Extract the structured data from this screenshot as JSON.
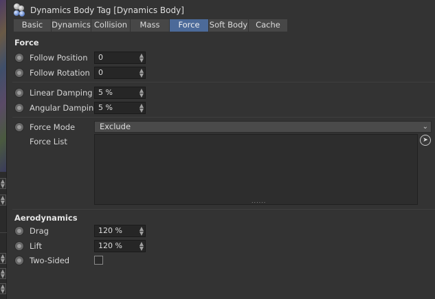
{
  "header": {
    "title": "Dynamics Body Tag [Dynamics Body]"
  },
  "tabs": [
    {
      "label": "Basic"
    },
    {
      "label": "Dynamics"
    },
    {
      "label": "Collision"
    },
    {
      "label": "Mass"
    },
    {
      "label": "Force",
      "active": true
    },
    {
      "label": "Soft Body"
    },
    {
      "label": "Cache"
    }
  ],
  "force": {
    "title": "Force",
    "follow_position": {
      "label": "Follow Position",
      "value": "0"
    },
    "follow_rotation": {
      "label": "Follow Rotation",
      "value": "0"
    },
    "linear_damping": {
      "label": "Linear Damping",
      "value": "5 %"
    },
    "angular_damping": {
      "label": "Angular Damping",
      "value": "5 %"
    },
    "force_mode": {
      "label": "Force Mode",
      "value": "Exclude"
    },
    "force_list": {
      "label": "Force List",
      "grip": "......"
    }
  },
  "aero": {
    "title": "Aerodynamics",
    "drag": {
      "label": "Drag",
      "value": "120 %"
    },
    "lift": {
      "label": "Lift",
      "value": "120 %"
    },
    "two_sided": {
      "label": "Two-Sided",
      "checked": false
    }
  },
  "colors": {
    "active_tab": "#4c6a99",
    "background": "#333333",
    "field": "#262626"
  },
  "icons": {
    "tag": "dynamics-body-tag-icon",
    "spin": "spinner-arrows-icon",
    "dropdown": "chevron-down-icon",
    "pick": "pick-object-icon"
  }
}
